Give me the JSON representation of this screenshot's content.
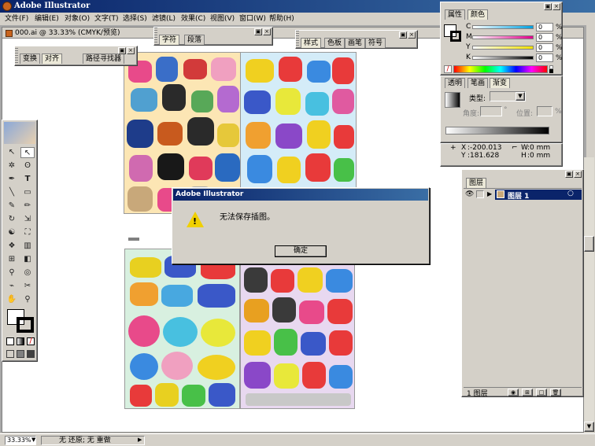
{
  "app": {
    "title": "Adobe Illustrator"
  },
  "menu": [
    "文件(F)",
    "编辑(E)",
    "对象(O)",
    "文字(T)",
    "选择(S)",
    "滤镜(L)",
    "效果(C)",
    "视图(V)",
    "窗口(W)",
    "帮助(H)"
  ],
  "document": {
    "title": "000.ai @ 33.33% (CMYK/预览)"
  },
  "panels": {
    "transform": {
      "tabs": [
        "变换",
        "对齐",
        "路径寻找器"
      ]
    },
    "character": {
      "tabs": [
        "字符",
        "段落"
      ]
    },
    "styles": {
      "tabs": [
        "样式",
        "色板",
        "画笔",
        "符号"
      ]
    },
    "color": {
      "tabs": [
        "属性",
        "颜色"
      ],
      "channels": [
        {
          "label": "C",
          "value": "0",
          "unit": "%"
        },
        {
          "label": "M",
          "value": "0",
          "unit": "%"
        },
        {
          "label": "Y",
          "value": "0",
          "unit": "%"
        },
        {
          "label": "K",
          "value": "0",
          "unit": "%"
        }
      ]
    },
    "gradient": {
      "tabs": [
        "透明",
        "笔画",
        "渐变"
      ],
      "type_label": "类型:",
      "angle_label": "角度:",
      "angle_unit": "°",
      "location_label": "位置:",
      "location_unit": "%"
    },
    "info": {
      "x_label": "X",
      "x_value": ":-200.013",
      "y_label": "Y",
      "y_value": ":181.628",
      "w_label": "W",
      "w_value": ":0 mm",
      "h_label": "H",
      "h_value": ":0 mm"
    },
    "layers": {
      "tabs": [
        "图层"
      ],
      "layer_name": "图层 1",
      "footer_count": "1 图层"
    }
  },
  "dialog": {
    "title": "Adobe Illustrator",
    "message": "无法保存插图。",
    "ok_label": "确定"
  },
  "status": {
    "zoom": "33.33%",
    "undo_status": "无 还原; 无 重做"
  },
  "colors": {
    "title_bar": "#0a246a",
    "layer_highlight": "#0a246a",
    "workspace": "#a8a8a8"
  }
}
